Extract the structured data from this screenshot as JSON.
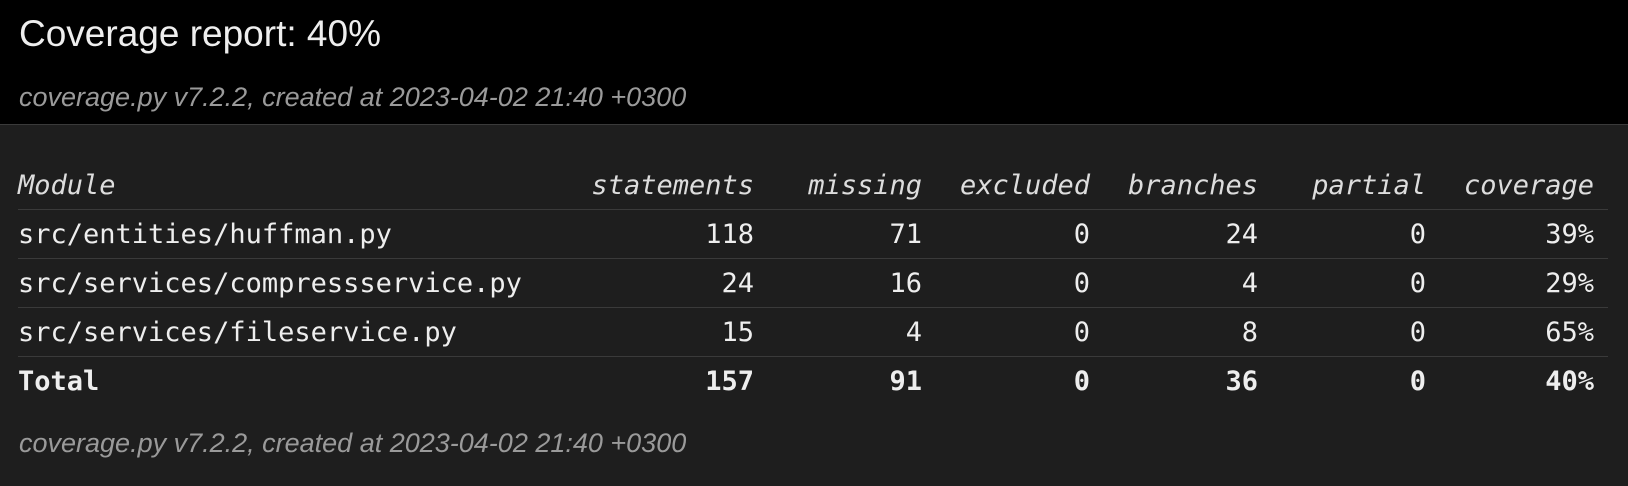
{
  "header": {
    "title": "Coverage report: 40%",
    "created": "coverage.py v7.2.2, created at 2023-04-02 21:40 +0300"
  },
  "table": {
    "columns": [
      "Module",
      "statements",
      "missing",
      "excluded",
      "branches",
      "partial",
      "coverage"
    ],
    "rows": [
      {
        "module": "src/entities/huffman.py",
        "statements": "118",
        "missing": "71",
        "excluded": "0",
        "branches": "24",
        "partial": "0",
        "coverage": "39%"
      },
      {
        "module": "src/services/compressservice.py",
        "statements": "24",
        "missing": "16",
        "excluded": "0",
        "branches": "4",
        "partial": "0",
        "coverage": "29%"
      },
      {
        "module": "src/services/fileservice.py",
        "statements": "15",
        "missing": "4",
        "excluded": "0",
        "branches": "8",
        "partial": "0",
        "coverage": "65%"
      }
    ],
    "total": {
      "module": "Total",
      "statements": "157",
      "missing": "91",
      "excluded": "0",
      "branches": "36",
      "partial": "0",
      "coverage": "40%"
    }
  },
  "footer": {
    "created": "coverage.py v7.2.2, created at 2023-04-02 21:40 +0300"
  }
}
